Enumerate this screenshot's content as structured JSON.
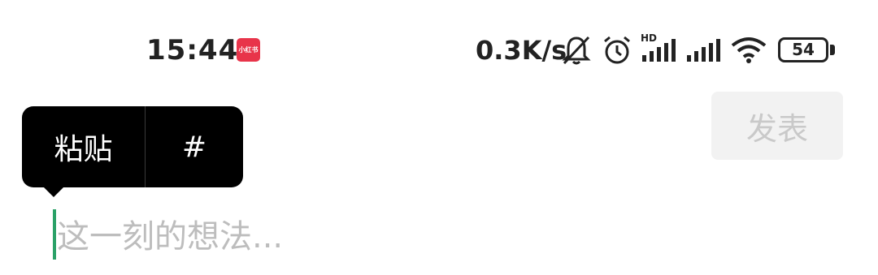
{
  "status_bar": {
    "time": "15:44",
    "app_badge_text": "小红书",
    "net_speed": "0.3K/s",
    "signal_label": "HD",
    "battery_level": "54"
  },
  "toolbar": {
    "publish_label": "发表"
  },
  "context_menu": {
    "paste_label": "粘贴",
    "hashtag_label": "#"
  },
  "composer": {
    "placeholder": "这一刻的想法..."
  },
  "colors": {
    "caret": "#2aa167",
    "badge": "#e8344a",
    "popup_bg": "#000000",
    "publish_disabled_bg": "#f2f2f2",
    "publish_disabled_text": "#c9c9c9"
  }
}
